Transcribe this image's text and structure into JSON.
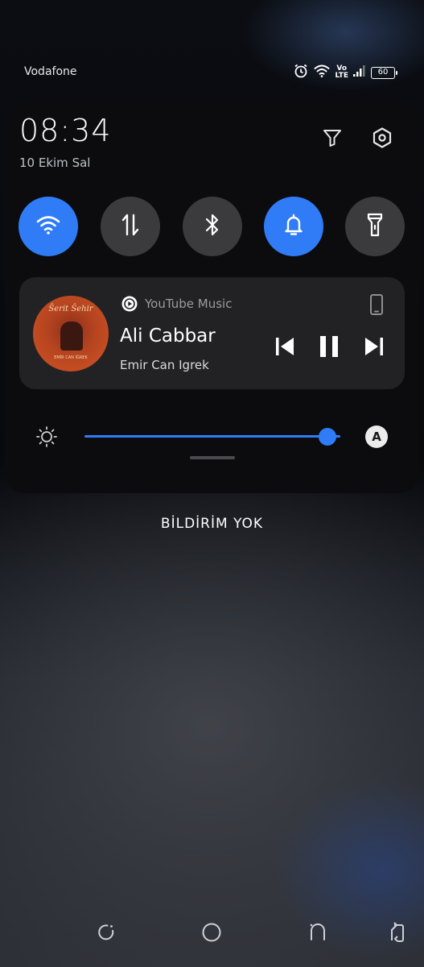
{
  "status_bar": {
    "carrier": "Vodafone",
    "volte_top": "Vo",
    "volte_bottom": "LTE",
    "battery": "60",
    "icons": [
      "alarm-icon",
      "wifi-icon",
      "volte-icon",
      "signal-icon",
      "battery-icon"
    ]
  },
  "header": {
    "time": "08:34",
    "date": "10 Ekim Sal",
    "icons": [
      "filter-icon",
      "settings-icon"
    ]
  },
  "quick_toggles": [
    {
      "name": "wifi",
      "icon": "wifi-icon",
      "active": true
    },
    {
      "name": "mobile-data",
      "icon": "data-transfer-icon",
      "active": false
    },
    {
      "name": "bluetooth",
      "icon": "bluetooth-icon",
      "active": false
    },
    {
      "name": "sound",
      "icon": "bell-icon",
      "active": true
    },
    {
      "name": "flashlight",
      "icon": "flashlight-icon",
      "active": false
    }
  ],
  "media": {
    "app_name": "YouTube Music",
    "song_title": "Ali Cabbar",
    "artist": "Emir Can Igrek",
    "album_art_text": "Ŝerit Ŝehir",
    "album_art_subtext": "EMİR CAN İĞREK",
    "controls": [
      "previous-icon",
      "pause-icon",
      "next-icon"
    ]
  },
  "brightness": {
    "level": 0.95,
    "auto_label": "A"
  },
  "notifications": {
    "empty_label": "BİLDİRİM YOK"
  },
  "nav_bar": [
    "recents-icon",
    "home-icon",
    "back-icon",
    "rotate-icon"
  ],
  "colors": {
    "accent": "#2f7cf6",
    "toggle_off": "#3b3b3d",
    "panel": "#0c0c0e",
    "media_card": "#222224"
  }
}
